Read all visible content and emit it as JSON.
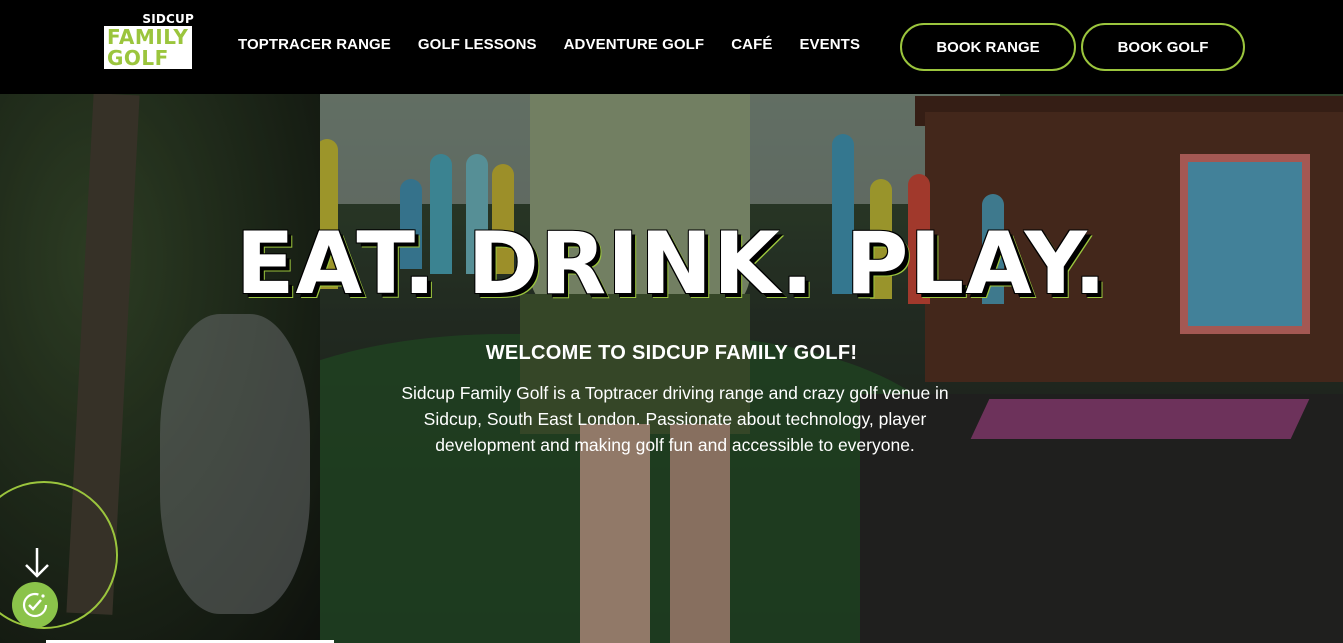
{
  "logo": {
    "top": "SIDCUP",
    "line1": "FAMILY",
    "line2": "GOLF"
  },
  "nav": {
    "items": [
      {
        "label": "TOPTRACER RANGE"
      },
      {
        "label": "GOLF LESSONS"
      },
      {
        "label": "ADVENTURE GOLF"
      },
      {
        "label": "CAFÉ"
      },
      {
        "label": "EVENTS"
      }
    ],
    "book_range": "BOOK RANGE",
    "book_golf": "BOOK GOLF"
  },
  "hero": {
    "headline": "EAT. DRINK. PLAY.",
    "subheading": "WELCOME TO SIDCUP FAMILY GOLF!",
    "description_lines": [
      "Sidcup Family Golf is a Toptracer driving range and crazy golf venue in",
      "Sidcup, South East London. Passionate about technology, player",
      "development and making golf fun and accessible to everyone."
    ]
  },
  "colors": {
    "accent": "#9bc53d",
    "background": "#000000"
  },
  "icons": {
    "scroll": "arrow-down-icon",
    "cookie": "cookie-consent-icon"
  }
}
